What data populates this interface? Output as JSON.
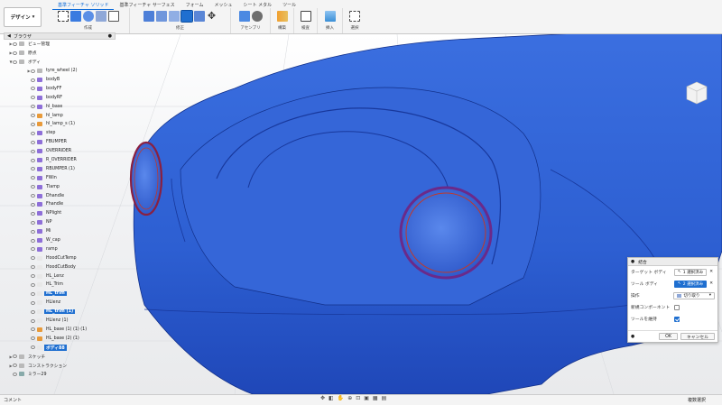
{
  "toolbar": {
    "design_label": "デザイン",
    "tabs": [
      "基準フィーチャ ソリッド",
      "基準フィーチャ サーフェス",
      "フォーム",
      "メッシュ",
      "シート メタル",
      "ツール"
    ],
    "groups": [
      "作成",
      "修正",
      "アセンブリ",
      "構築",
      "検査",
      "挿入",
      "選択"
    ]
  },
  "browser": {
    "title": "ブラウザ",
    "rows": [
      {
        "label": "ビュー管理",
        "level": 1,
        "arrow": "▶",
        "sel": false,
        "type": "folder"
      },
      {
        "label": "原点",
        "level": 1,
        "arrow": "▶",
        "sel": false,
        "type": "folder"
      },
      {
        "label": "ボディ",
        "level": 1,
        "arrow": "▼",
        "sel": false,
        "type": "folder"
      },
      {
        "label": "tyre_wheel (2)",
        "level": 2,
        "arrow": "▶",
        "sel": false,
        "type": "folder"
      },
      {
        "label": "bodyB",
        "level": 2,
        "arrow": "",
        "sel": false,
        "type": "purple"
      },
      {
        "label": "bodyFF",
        "level": 2,
        "arrow": "",
        "sel": false,
        "type": "purple"
      },
      {
        "label": "bodyRF",
        "level": 2,
        "arrow": "",
        "sel": false,
        "type": "purple"
      },
      {
        "label": "hl_base",
        "level": 2,
        "arrow": "",
        "sel": false,
        "type": "purple"
      },
      {
        "label": "hl_lamp",
        "level": 2,
        "arrow": "",
        "sel": false,
        "type": "orange"
      },
      {
        "label": "hl_lamp_s (1)",
        "level": 2,
        "arrow": "",
        "sel": false,
        "type": "orange"
      },
      {
        "label": "step",
        "level": 2,
        "arrow": "",
        "sel": false,
        "type": "purple"
      },
      {
        "label": "FBUMPER",
        "level": 2,
        "arrow": "",
        "sel": false,
        "type": "purple"
      },
      {
        "label": "OVERRIDER",
        "level": 2,
        "arrow": "",
        "sel": false,
        "type": "purple"
      },
      {
        "label": "R_OVERRIDER",
        "level": 2,
        "arrow": "",
        "sel": false,
        "type": "purple"
      },
      {
        "label": "RBUMPER (1)",
        "level": 2,
        "arrow": "",
        "sel": false,
        "type": "purple"
      },
      {
        "label": "FWin",
        "level": 2,
        "arrow": "",
        "sel": false,
        "type": "purple"
      },
      {
        "label": "Tlamp",
        "level": 2,
        "arrow": "",
        "sel": false,
        "type": "purple"
      },
      {
        "label": "Dhandle",
        "level": 2,
        "arrow": "",
        "sel": false,
        "type": "purple"
      },
      {
        "label": "Fhandle",
        "level": 2,
        "arrow": "",
        "sel": false,
        "type": "purple"
      },
      {
        "label": "NPlight",
        "level": 2,
        "arrow": "",
        "sel": false,
        "type": "purple"
      },
      {
        "label": "NP",
        "level": 2,
        "arrow": "",
        "sel": false,
        "type": "purple"
      },
      {
        "label": "Mi",
        "level": 2,
        "arrow": "",
        "sel": false,
        "type": "purple"
      },
      {
        "label": "W_cap",
        "level": 2,
        "arrow": "",
        "sel": false,
        "type": "purple"
      },
      {
        "label": "ramp",
        "level": 2,
        "arrow": "",
        "sel": false,
        "type": "purple"
      },
      {
        "label": "HoodCutTemp",
        "level": 2,
        "arrow": "",
        "sel": false,
        "type": "white"
      },
      {
        "label": "HoodCutBody",
        "level": 2,
        "arrow": "",
        "sel": false,
        "type": "white"
      },
      {
        "label": "HL_Lenz",
        "level": 2,
        "arrow": "",
        "sel": false,
        "type": "white"
      },
      {
        "label": "HL_Trim",
        "level": 2,
        "arrow": "",
        "sel": false,
        "type": "white"
      },
      {
        "label": "HL_trim",
        "level": 2,
        "arrow": "",
        "sel": true,
        "type": "white"
      },
      {
        "label": "HLlenz",
        "level": 2,
        "arrow": "",
        "sel": false,
        "type": "white"
      },
      {
        "label": "HL_trim (1)",
        "level": 2,
        "arrow": "",
        "sel": true,
        "type": "white"
      },
      {
        "label": "HLlenz (1)",
        "level": 2,
        "arrow": "",
        "sel": false,
        "type": "white"
      },
      {
        "label": "HL_base (1) (1) (1)",
        "level": 2,
        "arrow": "",
        "sel": false,
        "type": "orange"
      },
      {
        "label": "HL_base (2) (1)",
        "level": 2,
        "arrow": "",
        "sel": false,
        "type": "orange"
      },
      {
        "label": "ボディ88",
        "level": 2,
        "arrow": "",
        "sel": true,
        "type": "white"
      },
      {
        "label": "スケッチ",
        "level": 1,
        "arrow": "▶",
        "sel": false,
        "type": "folder"
      },
      {
        "label": "コンストラクション",
        "level": 1,
        "arrow": "▶",
        "sel": false,
        "type": "folder"
      },
      {
        "label": "ミラー29",
        "level": 1,
        "arrow": "",
        "sel": false,
        "type": "mirror"
      }
    ]
  },
  "dialog": {
    "title": "結合",
    "target_label": "ターゲット ボディ",
    "target_value": "1 選択済み",
    "tool_label": "ツール ボディ",
    "tool_value": "2 選択済み",
    "op_label": "操作",
    "op_value": "切り取り",
    "newcomp_label": "新規コンポーネント",
    "keep_label": "ツールを維持",
    "ok": "OK",
    "cancel": "キャンセル"
  },
  "comment": {
    "label": "コメント",
    "right": "複数選択"
  },
  "colors": {
    "body": "#2d5fd2",
    "select": "#1f6fd0",
    "trim": "#c0392b"
  }
}
